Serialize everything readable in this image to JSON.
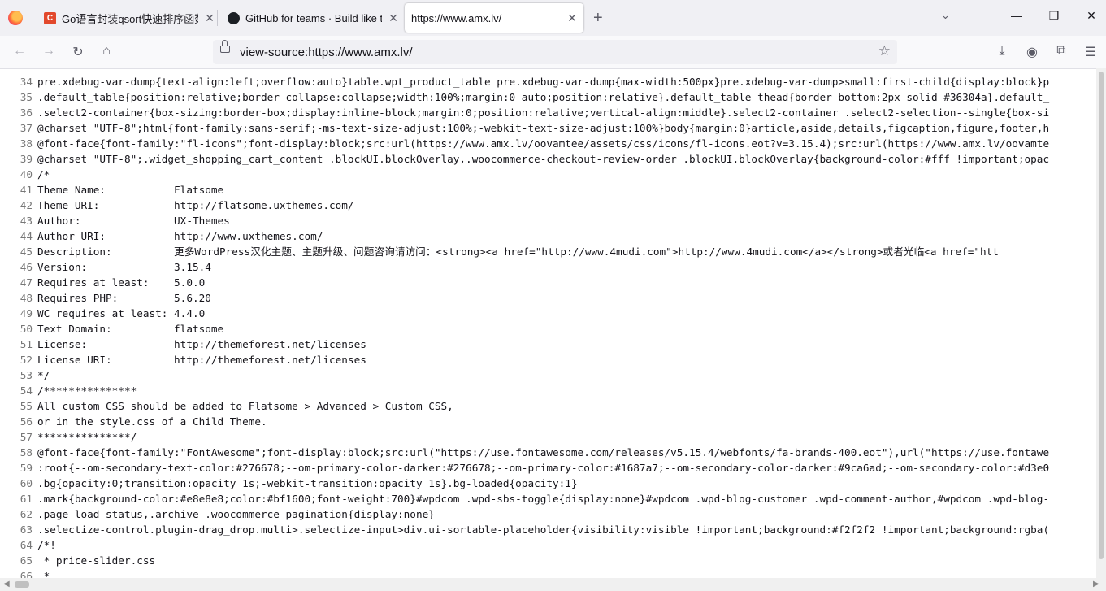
{
  "tabs": [
    {
      "title": "Go语言封装qsort快速排序函数"
    },
    {
      "title": "GitHub for teams · Build like the best"
    },
    {
      "title": "https://www.amx.lv/"
    }
  ],
  "address_bar": {
    "url": "view-source:https://www.amx.lv/"
  },
  "colors": {
    "accent": "#1a73e8",
    "tab_strip": "#f0f0f4",
    "line_number": "#777777"
  },
  "icons": {
    "back": "arrow-left-icon",
    "forward": "arrow-right-icon",
    "reload": "reload-icon",
    "home": "home-icon",
    "bookmark": "star-icon",
    "downloads": "download-icon",
    "account": "account-icon",
    "extensions": "puzzle-icon",
    "menu": "hamburger-menu-icon"
  },
  "source_lines": [
    {
      "num": "34",
      "text": "pre.xdebug-var-dump{text-align:left;overflow:auto}table.wpt_product_table pre.xdebug-var-dump{max-width:500px}pre.xdebug-var-dump>small:first-child{display:block}p"
    },
    {
      "num": "35",
      "text": ".default_table{position:relative;border-collapse:collapse;width:100%;margin:0 auto;position:relative}.default_table thead{border-bottom:2px solid #36304a}.default_"
    },
    {
      "num": "36",
      "text": ".select2-container{box-sizing:border-box;display:inline-block;margin:0;position:relative;vertical-align:middle}.select2-container .select2-selection--single{box-si"
    },
    {
      "num": "37",
      "text": "@charset \"UTF-8\";html{font-family:sans-serif;-ms-text-size-adjust:100%;-webkit-text-size-adjust:100%}body{margin:0}article,aside,details,figcaption,figure,footer,h"
    },
    {
      "num": "38",
      "text": "@font-face{font-family:\"fl-icons\";font-display:block;src:url(https://www.amx.lv/oovamtee/assets/css/icons/fl-icons.eot?v=3.15.4);src:url(https://www.amx.lv/oovamte"
    },
    {
      "num": "39",
      "text": "@charset \"UTF-8\";.widget_shopping_cart_content .blockUI.blockOverlay,.woocommerce-checkout-review-order .blockUI.blockOverlay{background-color:#fff !important;opac"
    },
    {
      "num": "40",
      "text": "/*"
    },
    {
      "num": "41",
      "text": "Theme Name:           Flatsome"
    },
    {
      "num": "42",
      "text": "Theme URI:            http://flatsome.uxthemes.com/"
    },
    {
      "num": "43",
      "text": "Author:               UX-Themes"
    },
    {
      "num": "44",
      "text": "Author URI:           http://www.uxthemes.com/"
    },
    {
      "num": "45",
      "text": "Description:          更多WordPress汉化主题、主题升级、问题咨询请访问：<strong><a href=\"http://www.4mudi.com\">http://www.4mudi.com</a></strong>或者光临<a href=\"htt"
    },
    {
      "num": "46",
      "text": "Version:              3.15.4"
    },
    {
      "num": "47",
      "text": "Requires at least:    5.0.0"
    },
    {
      "num": "48",
      "text": "Requires PHP:         5.6.20"
    },
    {
      "num": "49",
      "text": "WC requires at least: 4.4.0"
    },
    {
      "num": "50",
      "text": "Text Domain:          flatsome"
    },
    {
      "num": "51",
      "text": "License:              http://themeforest.net/licenses"
    },
    {
      "num": "52",
      "text": "License URI:          http://themeforest.net/licenses"
    },
    {
      "num": "53",
      "text": "*/"
    },
    {
      "num": "54",
      "text": "/***************"
    },
    {
      "num": "55",
      "text": "All custom CSS should be added to Flatsome > Advanced > Custom CSS,"
    },
    {
      "num": "56",
      "text": "or in the style.css of a Child Theme."
    },
    {
      "num": "57",
      "text": "***************/"
    },
    {
      "num": "58",
      "text": "@font-face{font-family:\"FontAwesome\";font-display:block;src:url(\"https://use.fontawesome.com/releases/v5.15.4/webfonts/fa-brands-400.eot\"),url(\"https://use.fontawe"
    },
    {
      "num": "59",
      "text": ":root{--om-secondary-text-color:#276678;--om-primary-color-darker:#276678;--om-primary-color:#1687a7;--om-secondary-color-darker:#9ca6ad;--om-secondary-color:#d3e0"
    },
    {
      "num": "60",
      "text": ".bg{opacity:0;transition:opacity 1s;-webkit-transition:opacity 1s}.bg-loaded{opacity:1}"
    },
    {
      "num": "61",
      "text": ".mark{background-color:#e8e8e8;color:#bf1600;font-weight:700}#wpdcom .wpd-sbs-toggle{display:none}#wpdcom .wpd-blog-customer .wpd-comment-author,#wpdcom .wpd-blog-"
    },
    {
      "num": "62",
      "text": ".page-load-status,.archive .woocommerce-pagination{display:none}"
    },
    {
      "num": "63",
      "text": ".selectize-control.plugin-drag_drop.multi>.selectize-input>div.ui-sortable-placeholder{visibility:visible !important;background:#f2f2f2 !important;background:rgba("
    },
    {
      "num": "64",
      "text": "/*!"
    },
    {
      "num": "65",
      "text": " * price-slider.css"
    },
    {
      "num": "66",
      "text": " *"
    }
  ]
}
